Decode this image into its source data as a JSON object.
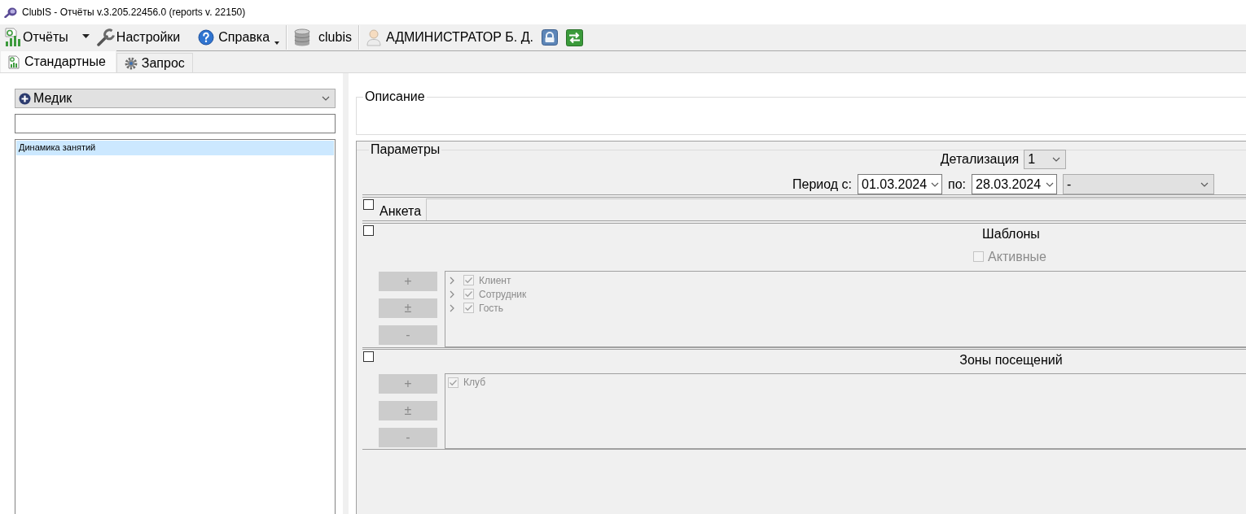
{
  "window": {
    "title": "ClubIS - Отчёты v.3.205.22456.0 (reports v. 22150)"
  },
  "toolbar": {
    "reports": {
      "label": "Отчёты"
    },
    "settings": {
      "label": "Настройки"
    },
    "help": {
      "label": "Справка"
    },
    "database": {
      "label": "clubis"
    },
    "user": {
      "label": "АДМИНИСТРАТОР Б. Д."
    }
  },
  "tabs": [
    {
      "kind": "standard",
      "label": "Стандартные",
      "selected": true
    },
    {
      "kind": "query",
      "label": "Запрос",
      "selected": false
    }
  ],
  "sidebar": {
    "category": {
      "value": "Медик"
    },
    "reports": [
      {
        "label": "Динамика занятий",
        "selected": true
      }
    ]
  },
  "description": {
    "title": "Описание"
  },
  "parameters": {
    "title": "Параметры",
    "detail": {
      "label": "Детализация",
      "value": "1"
    },
    "period": {
      "from_label": "Период с:",
      "from": "01.03.2024",
      "to_label": "по:",
      "to": "28.03.2024",
      "preset": "-"
    },
    "questionnaire": {
      "checked": false,
      "label": "Анкета",
      "disabled": true
    },
    "templates": {
      "checked": false,
      "title": "Шаблоны",
      "disabled": true,
      "active": {
        "label": "Активные",
        "checked": false
      },
      "buttons": [
        "+",
        "±",
        "-"
      ],
      "items": [
        {
          "label": "Клиент",
          "checked": true,
          "expanded": false
        },
        {
          "label": "Сотрудник",
          "checked": true,
          "expanded": false
        },
        {
          "label": "Гость",
          "checked": true,
          "expanded": false
        }
      ]
    },
    "visit_zones": {
      "checked": false,
      "title": "Зоны посещений",
      "disabled": true,
      "buttons": [
        "+",
        "±",
        "-"
      ],
      "items": [
        {
          "label": "Клуб",
          "checked": true
        }
      ]
    }
  }
}
